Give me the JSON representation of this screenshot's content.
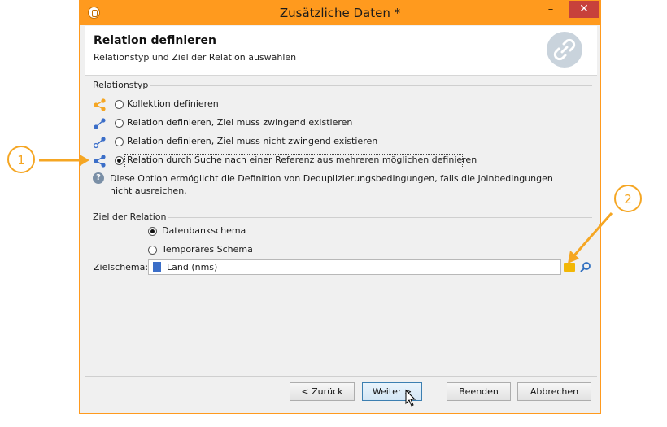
{
  "window": {
    "title": "Zusätzliche Daten *",
    "min_glyph": "–",
    "max_glyph": "□",
    "close_glyph": "✕"
  },
  "header": {
    "title": "Relation definieren",
    "subtitle": "Relationstyp und Ziel der Relation auswählen",
    "icon": "link-icon"
  },
  "relation_type": {
    "label": "Relationstyp",
    "options": [
      {
        "label": "Kollektion definieren",
        "icon": "collection-icon",
        "selected": false
      },
      {
        "label": "Relation definieren, Ziel muss zwingend existieren",
        "icon": "relation-icon",
        "selected": false
      },
      {
        "label": "Relation definieren, Ziel muss nicht zwingend existieren",
        "icon": "relation-optional-icon",
        "selected": false
      },
      {
        "label": "Relation durch Suche nach einer Referenz aus mehreren möglichen definieren",
        "icon": "multi-reference-icon",
        "selected": true
      }
    ],
    "info": "Diese Option ermöglicht die Definition von Deduplizierungsbedingungen, falls die Joinbedingungen nicht ausreichen."
  },
  "target": {
    "label": "Ziel der Relation",
    "options": [
      {
        "label": "Datenbankschema",
        "selected": true
      },
      {
        "label": "Temporäres Schema",
        "selected": false
      }
    ],
    "schema_label": "Zielschema:",
    "schema_value": "Land (nms)"
  },
  "buttons": {
    "back": "< Zurück",
    "next": "Weiter >",
    "finish": "Beenden",
    "cancel": "Abbrechen"
  },
  "annotations": {
    "callout_1": "1",
    "callout_2": "2"
  },
  "colors": {
    "titlebar": "#ff9a1e",
    "accent_orange": "#f5a623",
    "icon_blue": "#3b6ec8"
  }
}
